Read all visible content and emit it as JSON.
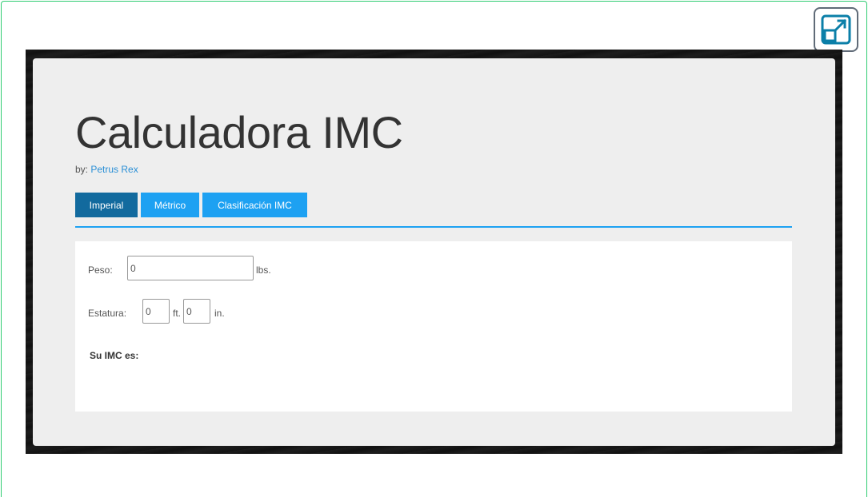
{
  "app": {
    "title": "Calculadora IMC",
    "byline_prefix": "by: ",
    "author": "Petrus Rex"
  },
  "tabs": [
    {
      "label": "Imperial",
      "active": true
    },
    {
      "label": "Métrico",
      "active": false
    },
    {
      "label": "Clasificación IMC",
      "active": false
    }
  ],
  "form": {
    "weight_label": "Peso:",
    "weight_value": "0",
    "weight_unit": "lbs.",
    "height_label": "Estatura:",
    "height_feet_value": "0",
    "height_feet_unit": "ft.",
    "height_inches_value": "0",
    "height_inches_unit": "in.",
    "result_label": "Su IMC es:"
  },
  "icons": {
    "expand": "expand-icon"
  },
  "colors": {
    "accent": "#1da1f2",
    "active_tab": "#126a9e",
    "frame_border": "#2ecc71"
  }
}
